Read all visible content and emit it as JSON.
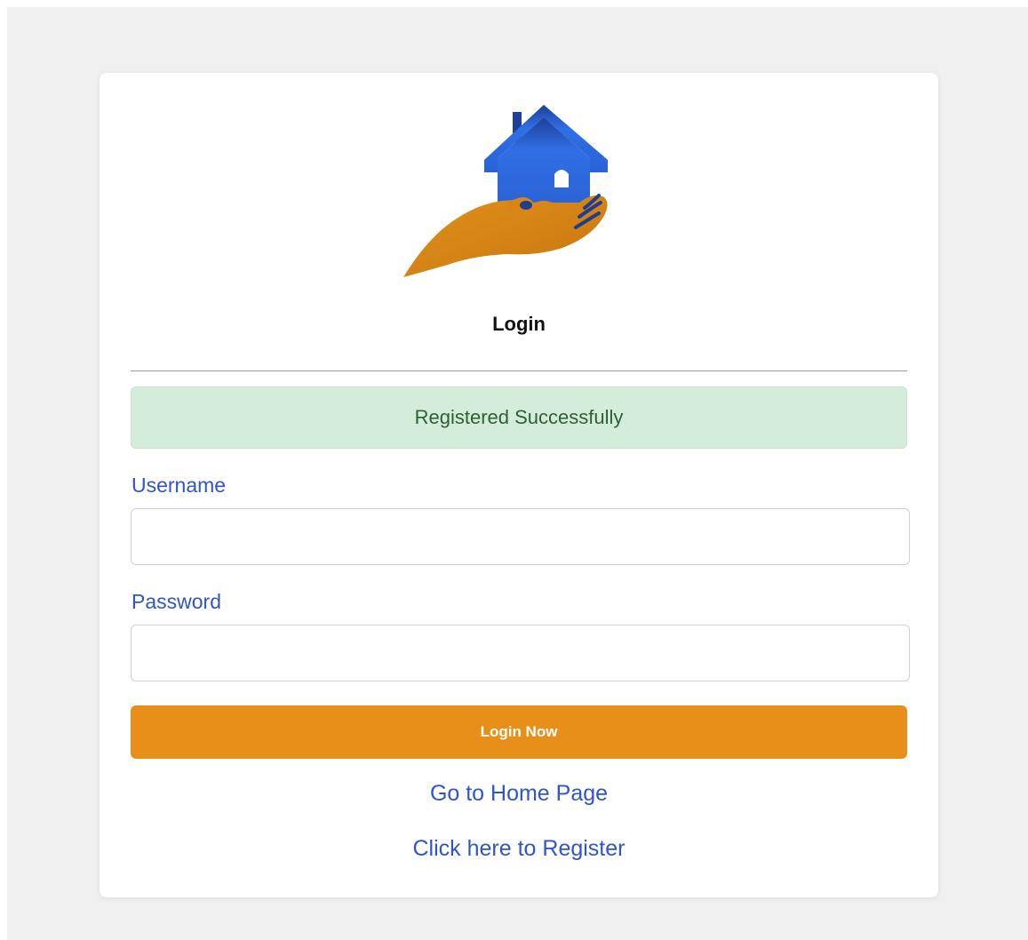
{
  "login": {
    "title": "Login",
    "alert_message": "Registered Successfully",
    "username_label": "Username",
    "username_value": "",
    "password_label": "Password",
    "password_value": "",
    "submit_label": "Login Now",
    "home_link": "Go to Home Page",
    "register_link": "Click here to Register"
  },
  "colors": {
    "accent_orange": "#e88f1a",
    "link_blue": "#2f55c8",
    "success_bg": "#d4edda",
    "success_text": "#2f5f35",
    "logo_house_blue": "#2f6fe4",
    "logo_hand_orange": "#d98516"
  },
  "icons": {
    "logo": "house-in-hand-logo"
  }
}
